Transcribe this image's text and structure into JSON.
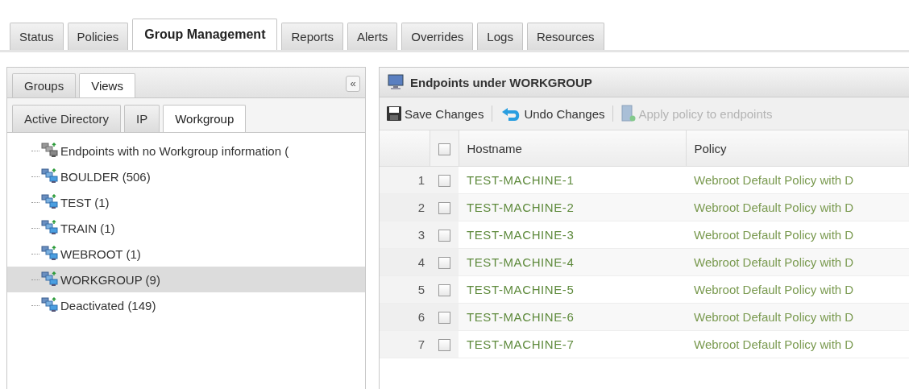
{
  "main_tabs": [
    {
      "label": "Status",
      "selected": false
    },
    {
      "label": "Policies",
      "selected": false
    },
    {
      "label": "Group Management",
      "selected": true
    },
    {
      "label": "Reports",
      "selected": false
    },
    {
      "label": "Alerts",
      "selected": false
    },
    {
      "label": "Overrides",
      "selected": false
    },
    {
      "label": "Logs",
      "selected": false
    },
    {
      "label": "Resources",
      "selected": false
    }
  ],
  "groups_panel": {
    "tabs": [
      {
        "label": "Groups",
        "selected": false
      },
      {
        "label": "Views",
        "selected": true
      }
    ],
    "collapse_button": "«",
    "view_tabs": [
      {
        "label": "Active Directory",
        "selected": false
      },
      {
        "label": "IP",
        "selected": false
      },
      {
        "label": "Workgroup",
        "selected": true
      }
    ],
    "tree_items": [
      {
        "label": "Endpoints with no Workgroup information (",
        "kind": "inactive",
        "selected": false
      },
      {
        "label": "BOULDER (506)",
        "kind": "group",
        "selected": false
      },
      {
        "label": "TEST (1)",
        "kind": "group",
        "selected": false
      },
      {
        "label": "TRAIN (1)",
        "kind": "group",
        "selected": false
      },
      {
        "label": "WEBROOT (1)",
        "kind": "group",
        "selected": false
      },
      {
        "label": "WORKGROUP (9)",
        "kind": "group",
        "selected": true
      },
      {
        "label": "Deactivated (149)",
        "kind": "group",
        "selected": false
      }
    ]
  },
  "endpoints_panel": {
    "title": "Endpoints under WORKGROUP",
    "toolbar": [
      {
        "label": "Save Changes",
        "kind": "save",
        "disabled": false
      },
      {
        "label": "Undo Changes",
        "kind": "undo",
        "disabled": false
      },
      {
        "label": "Apply policy to endpoints",
        "kind": "apply",
        "disabled": true
      }
    ],
    "select_all_checked": false,
    "columns": [
      "Hostname",
      "Policy"
    ],
    "rows": [
      {
        "number": "1",
        "checked": false,
        "hostname": "TEST-MACHINE-1",
        "policy": "Webroot Default Policy with D"
      },
      {
        "number": "2",
        "checked": false,
        "hostname": "TEST-MACHINE-2",
        "policy": "Webroot Default Policy with D"
      },
      {
        "number": "3",
        "checked": false,
        "hostname": "TEST-MACHINE-3",
        "policy": "Webroot Default Policy with D"
      },
      {
        "number": "4",
        "checked": false,
        "hostname": "TEST-MACHINE-4",
        "policy": "Webroot Default Policy with D"
      },
      {
        "number": "5",
        "checked": false,
        "hostname": "TEST-MACHINE-5",
        "policy": "Webroot Default Policy with D"
      },
      {
        "number": "6",
        "checked": false,
        "hostname": "TEST-MACHINE-6",
        "policy": "Webroot Default Policy with D"
      },
      {
        "number": "7",
        "checked": false,
        "hostname": "TEST-MACHINE-7",
        "policy": "Webroot Default Policy with D"
      }
    ]
  }
}
